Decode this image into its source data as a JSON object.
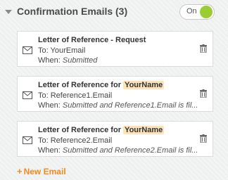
{
  "section": {
    "title": "Confirmation Emails (3)",
    "toggle_label": "On",
    "toggle_on_color": "#9acd32"
  },
  "emails": [
    {
      "title": "Letter of Reference - Request",
      "title_highlight": "",
      "to": "To: YourEmail",
      "when_label": "When:",
      "when_value": "Submitted"
    },
    {
      "title": "Letter of Reference for",
      "title_highlight": "YourName",
      "to": "To: Reference1.Email",
      "when_label": "When:",
      "when_value": "Submitted and Reference1.Email is fil..."
    },
    {
      "title": "Letter of Reference for",
      "title_highlight": "YourName",
      "to": "To: Reference2.Email",
      "when_label": "When:",
      "when_value": "Submitted and Reference2.Email is fil..."
    }
  ],
  "actions": {
    "new_email_plus": "+",
    "new_email_label": "New Email",
    "accent_color": "#f08a24"
  },
  "icons": {
    "caret": "caret-down-icon",
    "envelope": "envelope-icon",
    "trash": "trash-icon"
  }
}
